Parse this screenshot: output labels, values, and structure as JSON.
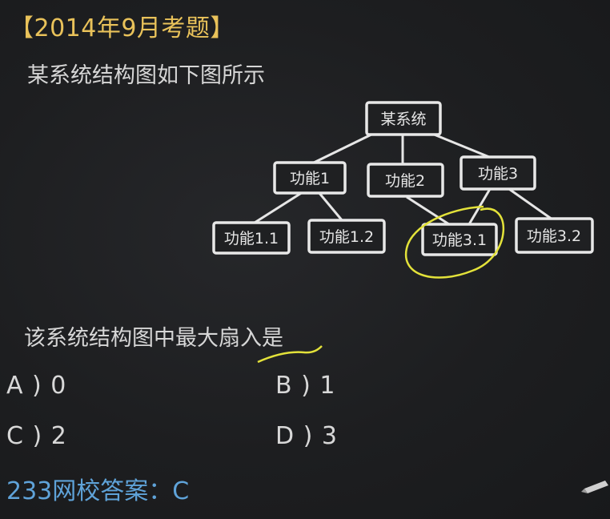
{
  "header": {
    "exam_title": "【2014年9月考题】",
    "intro": "某系统结构图如下图所示"
  },
  "diagram": {
    "root": "某系统",
    "level1": [
      "功能1",
      "功能2",
      "功能3"
    ],
    "level2": [
      "功能1.1",
      "功能1.2",
      "功能3.1",
      "功能3.2"
    ],
    "highlight_color": "#e3e23a"
  },
  "question": {
    "text": "该系统结构图中最大扇入是"
  },
  "options": {
    "a": "A ) 0",
    "b": "B ) 1",
    "c": "C ) 2",
    "d": "D ) 3"
  },
  "answer": {
    "text": "233网校答案：C",
    "color": "#5fa3d9"
  },
  "colors": {
    "title": "#e9c25a",
    "background": "#1c1d1f",
    "node_stroke": "#e8e8e8"
  }
}
